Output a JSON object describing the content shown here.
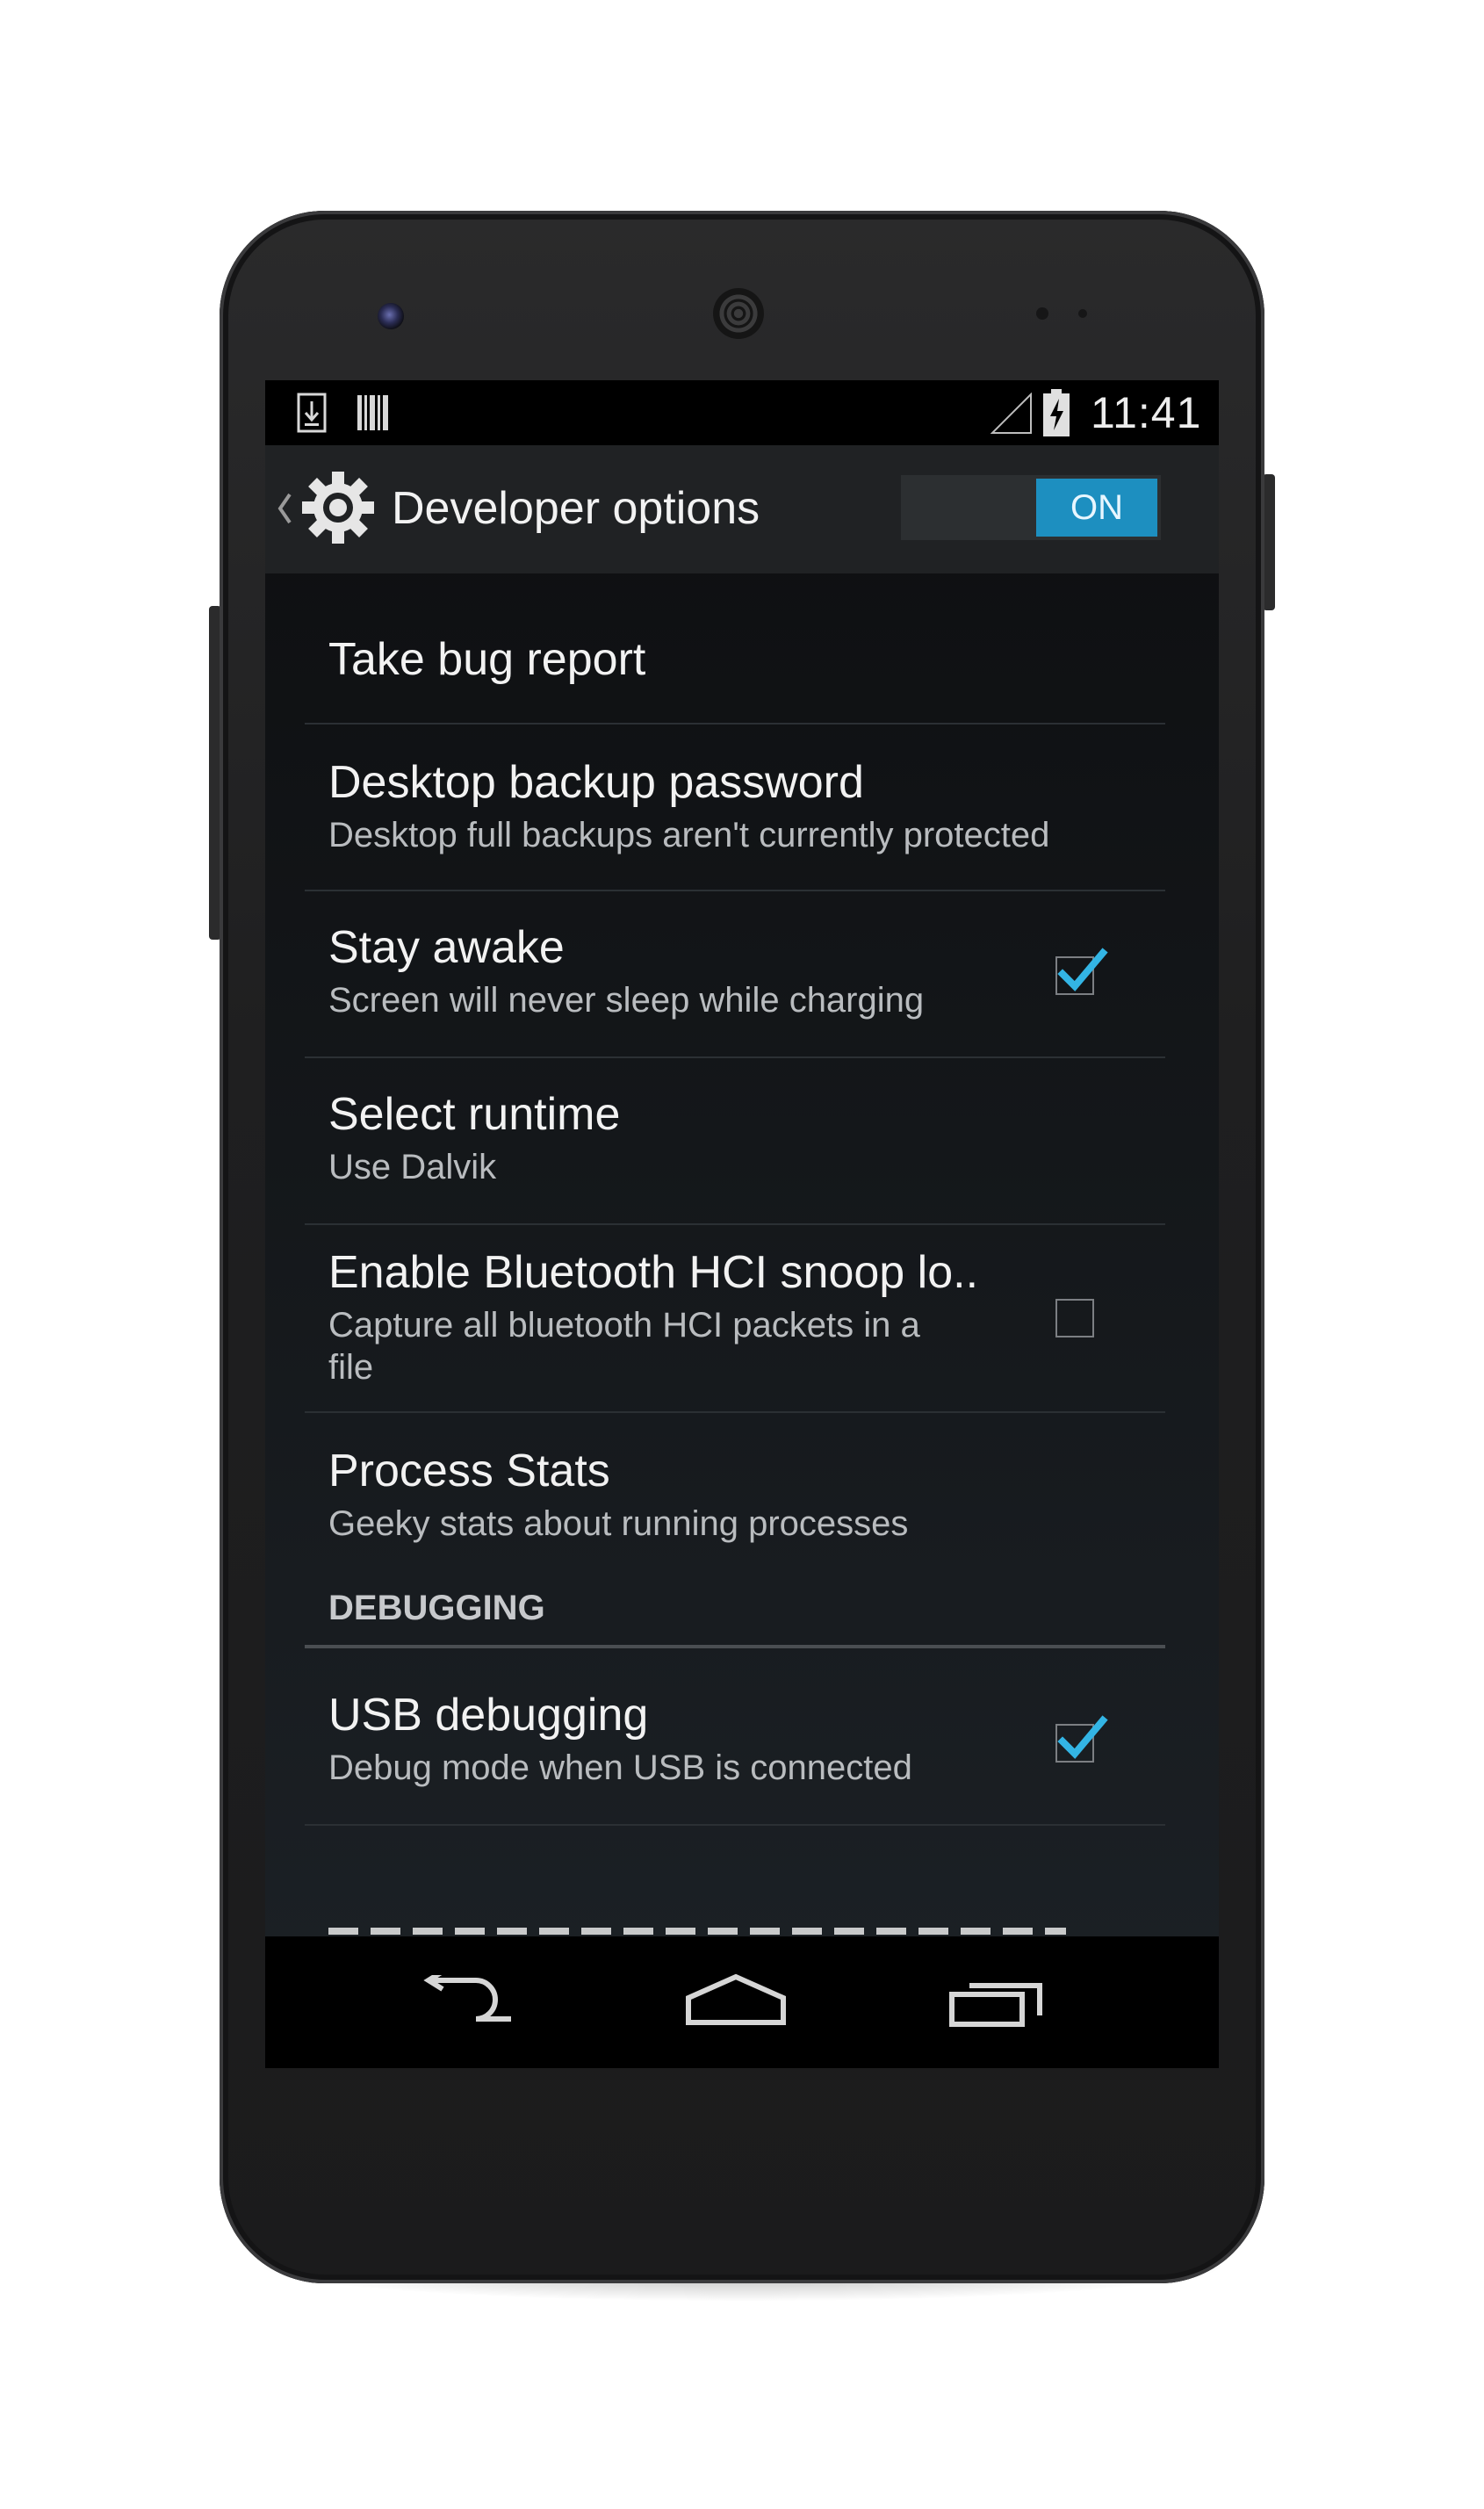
{
  "status_bar": {
    "time": "11:41",
    "icons": [
      "download-notification-icon",
      "barcode-notification-icon",
      "signal-icon",
      "battery-charging-icon"
    ]
  },
  "action_bar": {
    "title": "Developer options",
    "toggle_label": "ON",
    "toggle_state": true,
    "accent": "#1d8fc0"
  },
  "preferences": [
    {
      "title": "Take bug report",
      "summary": ""
    },
    {
      "title": "Desktop backup password",
      "summary": "Desktop full backups aren't currently protected"
    },
    {
      "title": "Stay awake",
      "summary": "Screen will never sleep while charging",
      "checked": true
    },
    {
      "title": "Select runtime",
      "summary": "Use Dalvik"
    },
    {
      "title": "Enable Bluetooth HCI snoop lo..",
      "summary": "Capture all bluetooth HCI packets in a file",
      "checked": false
    },
    {
      "title": "Process Stats",
      "summary": "Geeky stats about running processes"
    }
  ],
  "section_header": "DEBUGGING",
  "debugging": [
    {
      "title": "USB debugging",
      "summary": "Debug mode when USB is connected",
      "checked": true
    }
  ],
  "nav_bar": {
    "buttons": [
      "back-icon",
      "home-icon",
      "recents-icon"
    ]
  }
}
